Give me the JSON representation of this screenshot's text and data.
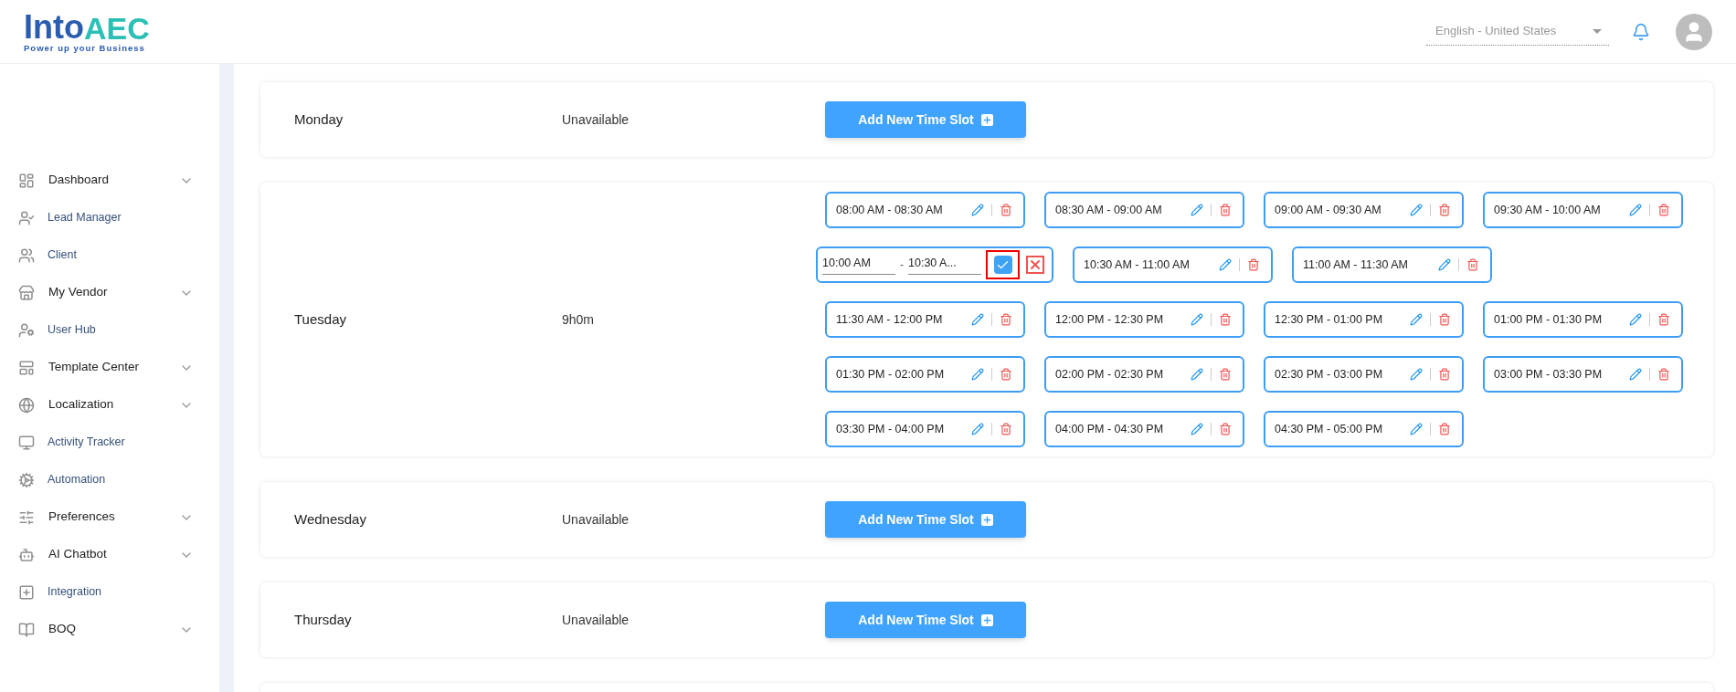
{
  "logo": {
    "word": "Into",
    "mark": "AEC",
    "tagline": "Power up your Business"
  },
  "header": {
    "language": "English - United States"
  },
  "sidebar": {
    "items": [
      {
        "label": "Dashboard",
        "kind": "group"
      },
      {
        "label": "Lead Manager",
        "kind": "link"
      },
      {
        "label": "Client",
        "kind": "link"
      },
      {
        "label": "My Vendor",
        "kind": "group"
      },
      {
        "label": "User Hub",
        "kind": "link"
      },
      {
        "label": "Template Center",
        "kind": "group"
      },
      {
        "label": "Localization",
        "kind": "group"
      },
      {
        "label": "Activity Tracker",
        "kind": "link"
      },
      {
        "label": "Automation",
        "kind": "link"
      },
      {
        "label": "Preferences",
        "kind": "group"
      },
      {
        "label": "AI Chatbot",
        "kind": "group"
      },
      {
        "label": "Integration",
        "kind": "link"
      },
      {
        "label": "BOQ",
        "kind": "group"
      }
    ]
  },
  "days": [
    {
      "day": "Monday",
      "kind": "unavailable",
      "status": "Unavailable",
      "button": "Add New Time Slot"
    },
    {
      "day": "Tuesday",
      "kind": "slots",
      "status": "9h0m",
      "slots": [
        {
          "kind": "slot",
          "label": "08:00 AM - 08:30 AM"
        },
        {
          "kind": "slot",
          "label": "08:30 AM - 09:00 AM"
        },
        {
          "kind": "slot",
          "label": "09:00 AM - 09:30 AM"
        },
        {
          "kind": "slot",
          "label": "09:30 AM - 10:00 AM"
        },
        {
          "kind": "editing",
          "start": "10:00 AM",
          "separator": "-",
          "end": "10:30 A...",
          "confirm_focused": true
        },
        {
          "kind": "slot",
          "label": "10:30 AM - 11:00 AM"
        },
        {
          "kind": "slot",
          "label": "11:00 AM - 11:30 AM"
        },
        {
          "kind": "slot",
          "label": "11:30 AM - 12:00 PM"
        },
        {
          "kind": "slot",
          "label": "12:00 PM - 12:30 PM"
        },
        {
          "kind": "slot",
          "label": "12:30 PM - 01:00 PM"
        },
        {
          "kind": "slot",
          "label": "01:00 PM - 01:30 PM"
        },
        {
          "kind": "slot",
          "label": "01:30 PM - 02:00 PM"
        },
        {
          "kind": "slot",
          "label": "02:00 PM - 02:30 PM"
        },
        {
          "kind": "slot",
          "label": "02:30 PM - 03:00 PM"
        },
        {
          "kind": "slot",
          "label": "03:00 PM - 03:30 PM"
        },
        {
          "kind": "slot",
          "label": "03:30 PM - 04:00 PM"
        },
        {
          "kind": "slot",
          "label": "04:00 PM - 04:30 PM"
        },
        {
          "kind": "slot",
          "label": "04:30 PM - 05:00 PM"
        }
      ]
    },
    {
      "day": "Wednesday",
      "kind": "unavailable",
      "status": "Unavailable",
      "button": "Add New Time Slot"
    },
    {
      "day": "Thursday",
      "kind": "unavailable",
      "status": "Unavailable",
      "button": "Add New Time Slot"
    }
  ]
}
